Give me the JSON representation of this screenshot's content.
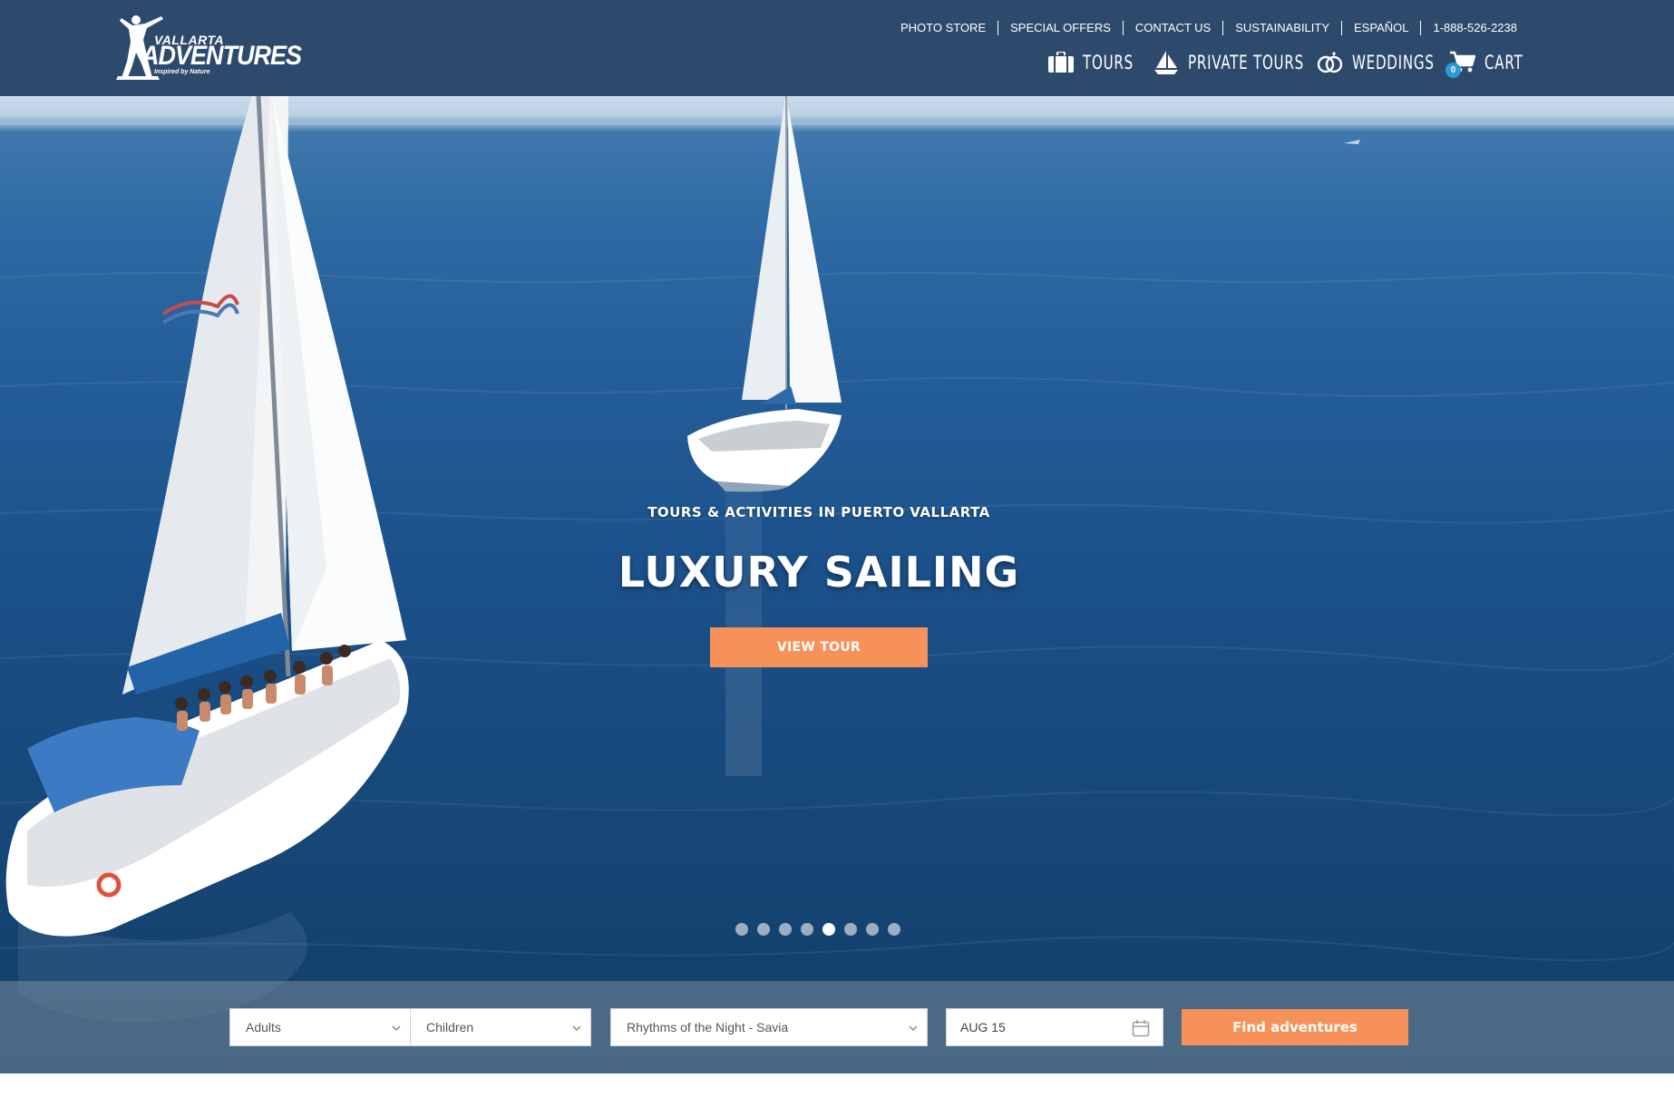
{
  "brand": {
    "logo_line1": "VALLARTA",
    "logo_line2": "ADVENTURES",
    "logo_tagline": "Inspired by Nature"
  },
  "top_links": [
    "PHOTO STORE",
    "SPECIAL OFFERS",
    "CONTACT US",
    "SUSTAINABILITY",
    "ESPAÑOL",
    "1-888-526-2238"
  ],
  "main_nav": {
    "tours": {
      "label": "TOURS",
      "icon": "suitcase-icon"
    },
    "private_tours": {
      "label": "PRIVATE TOURS",
      "icon": "sailboat-icon"
    },
    "weddings": {
      "label": "WEDDINGS",
      "icon": "rings-icon"
    },
    "cart": {
      "label": "CART",
      "icon": "cart-icon",
      "count": "0"
    }
  },
  "hero": {
    "subtitle": "TOURS & ACTIVITIES IN PUERTO VALLARTA",
    "title": "LUXURY SAILING",
    "cta_label": "VIEW TOUR",
    "slides_total": 8,
    "active_slide": 5
  },
  "search": {
    "adults_label": "Adults",
    "children_label": "Children",
    "tour_value": "Rhythms of the Night - Savia",
    "date_value": "AUG 15",
    "submit_label": "Find adventures"
  },
  "colors": {
    "header_bg": "#2d4a6c",
    "accent_orange": "#f7915a",
    "badge_blue": "#2a9bd6"
  }
}
